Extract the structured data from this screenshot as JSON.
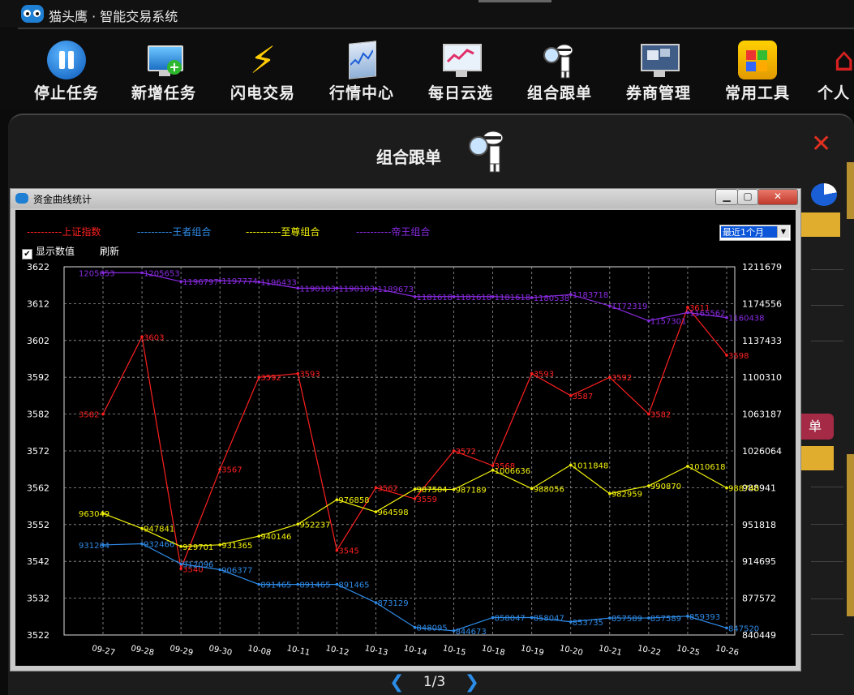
{
  "app": {
    "title": "猫头鹰 · 智能交易系统"
  },
  "toolbar": {
    "items": [
      {
        "label": "停止任务",
        "icon": "pause-icon"
      },
      {
        "label": "新增任务",
        "icon": "add-monitor-icon"
      },
      {
        "label": "闪电交易",
        "icon": "lightning-icon"
      },
      {
        "label": "行情中心",
        "icon": "market-chart-icon"
      },
      {
        "label": "每日云选",
        "icon": "cloud-pick-icon"
      },
      {
        "label": "组合跟单",
        "icon": "detective-icon"
      },
      {
        "label": "券商管理",
        "icon": "broker-icon"
      },
      {
        "label": "常用工具",
        "icon": "tools-icon"
      },
      {
        "label": "个人",
        "icon": "home-icon"
      }
    ]
  },
  "panel": {
    "title": "组合跟单",
    "side_button": "单",
    "page": "1/3",
    "prev": "❮",
    "next": "❯"
  },
  "dialog": {
    "title": "资金曲线统计",
    "period_select": "最近1个月",
    "show_values_label": "显示数值",
    "refresh_label": "刷新"
  },
  "chart_data": {
    "type": "line",
    "x": [
      "09-27",
      "09-28",
      "09-29",
      "09-30",
      "10-08",
      "10-11",
      "10-12",
      "10-13",
      "10-14",
      "10-15",
      "10-18",
      "10-19",
      "10-20",
      "10-21",
      "10-22",
      "10-25",
      "10-26"
    ],
    "left_axis": {
      "ticks": [
        3622,
        3612,
        3602,
        3592,
        3582,
        3572,
        3562,
        3552,
        3542,
        3532,
        3522
      ],
      "ylim": [
        3522,
        3622
      ]
    },
    "right_axis": {
      "ticks": [
        1211679,
        1174556,
        1137433,
        1100310,
        1063187,
        1026064,
        988941,
        951818,
        914695,
        877572,
        840449
      ],
      "ylim": [
        840449,
        1211679
      ]
    },
    "grid": true,
    "legend_placement": "top",
    "series": [
      {
        "name": "上证指数",
        "color": "#ff2020",
        "axis": "left",
        "values": [
          3582,
          3603,
          3540,
          3567,
          3592,
          3593,
          3545,
          3562,
          3559,
          3572,
          3568,
          3593,
          3587,
          3592,
          3582,
          3611,
          3598
        ],
        "labels": [
          "3582",
          "3603",
          "3540",
          "3567",
          "3592",
          "3593",
          "3545",
          "3562",
          "3559",
          "3572",
          "3568",
          "3593",
          "3587",
          "3592",
          "3582",
          "3611",
          "3598"
        ]
      },
      {
        "name": "王者组合",
        "color": "#2f8be8",
        "axis": "right",
        "values": [
          931264,
          932466,
          912096,
          906377,
          891465,
          891465,
          891465,
          873129,
          848095,
          844673,
          858047,
          858047,
          853735,
          857589,
          857589,
          859393,
          847520
        ],
        "labels": [
          "931264",
          "932466",
          "912096",
          "906377",
          "891465",
          "891465",
          "891465",
          "873129",
          "848095",
          "844673",
          "858047",
          "858047",
          "853735",
          "857589",
          "857589",
          "859393",
          "847520"
        ]
      },
      {
        "name": "至尊组合",
        "color": "#f2f20a",
        "axis": "right",
        "values": [
          963049,
          947841,
          929701,
          931365,
          940146,
          952237,
          976858,
          964598,
          987504,
          987189,
          1006636,
          988056,
          1011848,
          982959,
          990870,
          1010618,
          988740
        ],
        "labels": [
          "963049",
          "947841",
          "929701",
          "931365",
          "940146",
          "952237",
          "976858",
          "964598",
          "987504",
          "987189",
          "1006636",
          "988056",
          "1011848",
          "982959",
          "990870",
          "1010618",
          "988740"
        ]
      },
      {
        "name": "帝王组合",
        "color": "#8a2be2",
        "axis": "right",
        "values": [
          1205653,
          1205653,
          1196797,
          1197774,
          1196433,
          1190103,
          1190103,
          1189673,
          1181618,
          1181618,
          1181618,
          1180538,
          1183718,
          1172319,
          1157301,
          1165562,
          1160438
        ],
        "labels": [
          "1205653",
          "1205653",
          "1196797",
          "1197774",
          "1196433",
          "1190103",
          "1190103",
          "1189673",
          "1181618",
          "1181618",
          "1181618",
          "1180538",
          "1183718",
          "1172319",
          "1157301",
          "1165562",
          "1160438"
        ]
      }
    ],
    "legend": [
      {
        "dashes": "----------",
        "name": "上证指数",
        "color": "#ff2020"
      },
      {
        "dashes": "----------",
        "name": "王者组合",
        "color": "#2f8be8"
      },
      {
        "dashes": "----------",
        "name": "至尊组合",
        "color": "#f2f20a"
      },
      {
        "dashes": "----------",
        "name": "帝王组合",
        "color": "#8a2be2"
      }
    ]
  }
}
